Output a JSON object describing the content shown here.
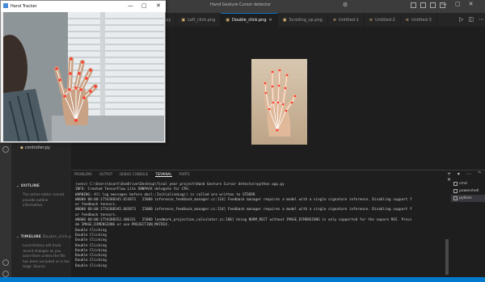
{
  "titlebar": {
    "title": "Hand Gesture Cursor detector",
    "icons": [
      "gear-icon",
      "layout-sidebar-icon",
      "layout-panel-icon",
      "layout-split-icon",
      "layout-custom-icon"
    ]
  },
  "window_controls": {
    "minimize": "—",
    "maximize": "▢",
    "close": "✕"
  },
  "tabs": [
    {
      "label": "main.py",
      "partial": "ain.py",
      "active": false
    },
    {
      "label": "Left_click.png",
      "active": false
    },
    {
      "label": "Double_click.png",
      "active": true
    },
    {
      "label": "Scrolling_up.png",
      "active": false
    },
    {
      "label": "Untitled-1",
      "active": false
    },
    {
      "label": "Untitled-2",
      "active": false
    },
    {
      "label": "Untitled-3",
      "active": false
    }
  ],
  "sidebar": {
    "file": "controller.py",
    "outline": {
      "heading": "OUTLINE",
      "body": "The active editor cannot provide outline information."
    },
    "timeline": {
      "heading": "TIMELINE",
      "file": "Double_click.png",
      "body": "Local History will track recent changes as you save them unless the file has been excluded or is too large. Source"
    }
  },
  "panel": {
    "tabs": [
      "PROBLEMS",
      "OUTPUT",
      "DEBUG CONSOLE",
      "TERMINAL",
      "PORTS"
    ],
    "active_tab": "TERMINAL",
    "actions": "+ ▾ ⋯ ^ ✕",
    "terminal_lines": [
      "(venv) C:\\Users\\ksart\\OneDrive\\Desktop\\final year project\\Hand Gesture Cursor detector>python app.py",
      "INFO: Created TensorFlow Lite XNNPACK delegate for CPU.",
      "WARNING: All log messages before absl::InitializeLog() is called are written to STDERR",
      "W0000 00:00:1754388345.653873   25080 inference_feedback_manager.cc:114] Feedback manager requires a model with a single signature inference. Disabling support f",
      "or feedback tensors.",
      "W0000 00:00:1754388345.683873   25080 inference_feedback_manager.cc:114] Feedback manager requires a model with a single signature inference. Disabling support f",
      "or feedback tensors.",
      "W0000 00:00:1754388352.406331   25080 landmark_projection_calculator.cc:186] Using NORM_RECT without IMAGE_DIMENSIONS is only supported for the square ROI. Provi",
      "de IMAGE_DIMENSIONS or use PROJECTION_MATRIX.",
      "Double Clicking",
      "Double Clicking",
      "Double Clicking",
      "Double Clicking",
      "Double Clicking",
      "Double Clicking",
      "Double Clicking",
      "Double Clicking"
    ],
    "terminals": [
      {
        "label": "cmd",
        "active": false
      },
      {
        "label": "powershell",
        "active": false
      },
      {
        "label": "python",
        "active": true
      }
    ]
  },
  "hand_window": {
    "title": "Hand Tracker",
    "controls": {
      "minimize": "—",
      "maximize": "▢",
      "close": "✕"
    }
  },
  "colors": {
    "accent": "#007acc",
    "landmark": "#ff3b30",
    "connection": "#ffffff"
  }
}
